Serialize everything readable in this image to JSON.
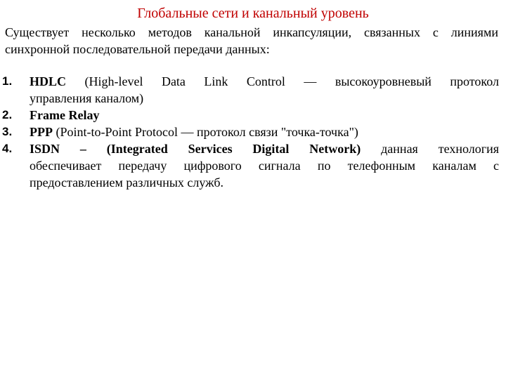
{
  "title": "Глобальные сети и канальный уровень",
  "intro": {
    "line1": "Существует несколько методов канальной инкапсуляции, связанных с линиями",
    "line2": "синхронной последовательной передачи данных:"
  },
  "list": [
    {
      "number": "1.",
      "term": "HDLC",
      "first_line_rest": " (High-level Data Link Control — высокоуровневый протокол",
      "rest": "управления каналом)"
    },
    {
      "number": "2.",
      "term": "Frame Relay"
    },
    {
      "number": "3.",
      "term": "PPP",
      "desc": " (Point-to-Point Protocol — протокол связи \"точка-точка\")"
    },
    {
      "number": "4.",
      "term": "ISDN – (Integrated Services Digital Network)",
      "first_line_rest": " данная технология",
      "line2": "обеспечивает передачу цифрового сигнала по телефонным каналам с",
      "line3": "предоставлением различных служб."
    }
  ]
}
